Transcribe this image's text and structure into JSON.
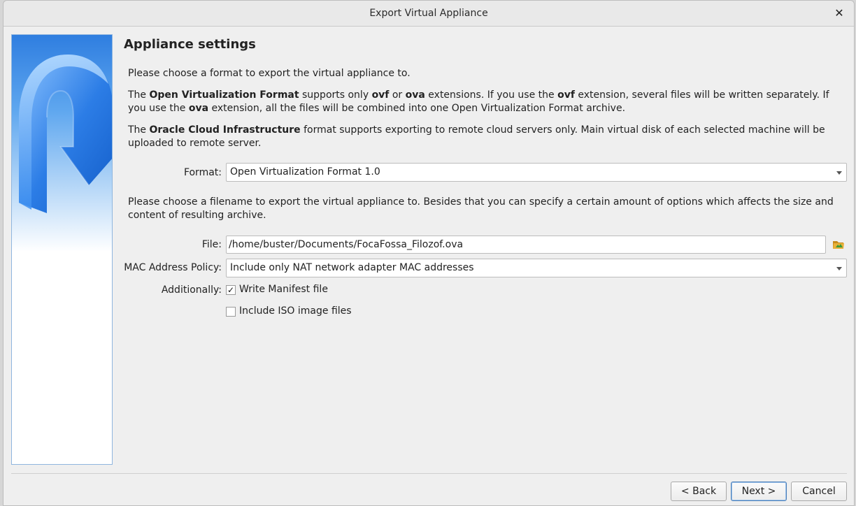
{
  "window": {
    "title": "Export Virtual Appliance",
    "close_glyph": "✕"
  },
  "page": {
    "heading": "Appliance settings",
    "intro": "Please choose a format to export the virtual appliance to.",
    "ovf_para": {
      "p1": "The ",
      "b1": "Open Virtualization Format",
      "p2": " supports only ",
      "b2": "ovf",
      "p3": " or ",
      "b3": "ova",
      "p4": " extensions. If you use the ",
      "b4": "ovf",
      "p5": " extension, several files will be written separately. If you use the ",
      "b5": "ova",
      "p6": " extension, all the files will be combined into one Open Virtualization Format archive."
    },
    "oci_para": {
      "p1": "The ",
      "b1": "Oracle Cloud Infrastructure",
      "p2": " format supports exporting to remote cloud servers only. Main virtual disk of each selected machine will be uploaded to remote server."
    },
    "filename_para": "Please choose a filename to export the virtual appliance to. Besides that you can specify a certain amount of options which affects the size and content of resulting archive."
  },
  "form": {
    "format_label": "Format:",
    "format_value": "Open Virtualization Format 1.0",
    "file_label": "File:",
    "file_value": "/home/buster/Documents/FocaFossa_Filozof.ova",
    "mac_label": "MAC Address Policy:",
    "mac_value": "Include only NAT network adapter MAC addresses",
    "additionally_label": "Additionally:",
    "write_manifest_label": "Write Manifest file",
    "write_manifest_checked": true,
    "include_iso_label": "Include ISO image files",
    "include_iso_checked": false
  },
  "icons": {
    "folder": "folder-open-icon",
    "watermark": "virtualbox-export-arrow-icon"
  },
  "buttons": {
    "back": "< Back",
    "next": "Next >",
    "cancel": "Cancel"
  },
  "colors": {
    "accent": "#2f7ee0",
    "default_button_border": "#4b7fb8"
  }
}
